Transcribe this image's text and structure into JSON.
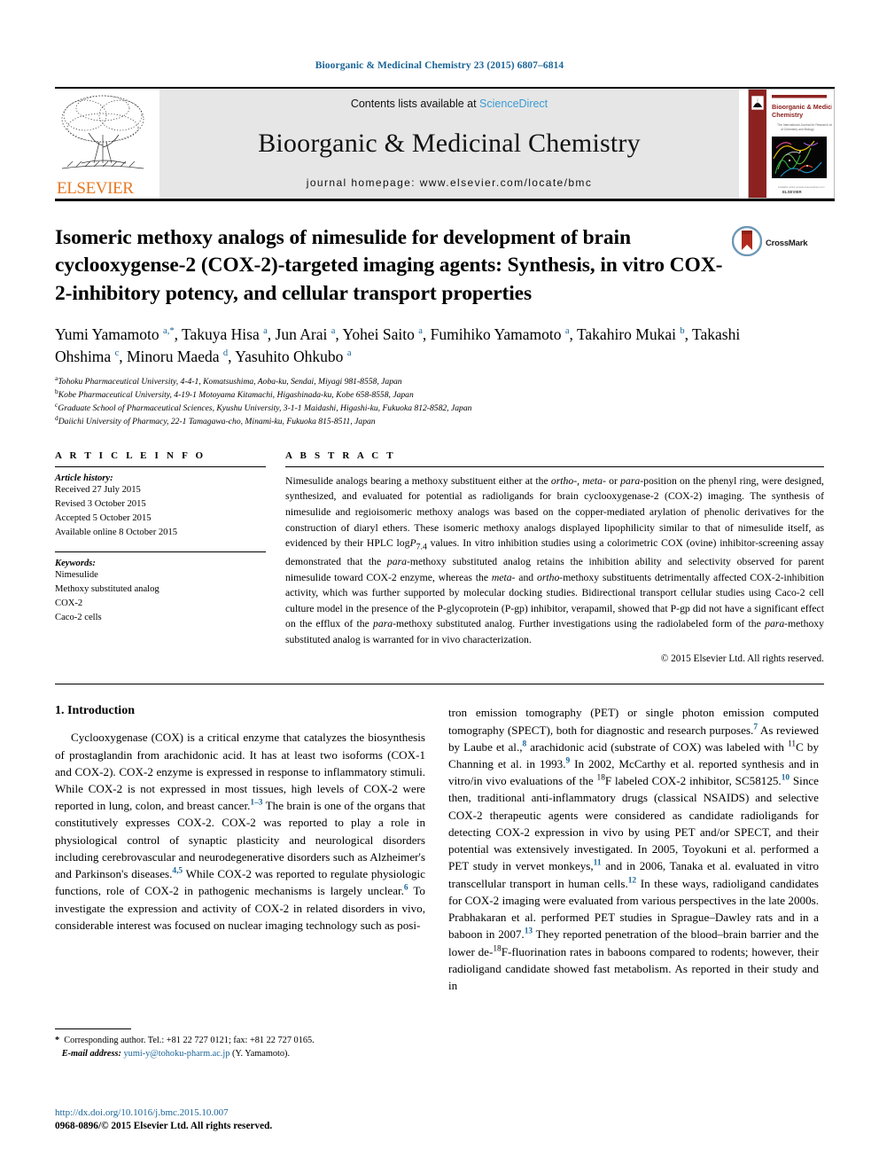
{
  "running_head": "Bioorganic & Medicinal Chemistry 23 (2015) 6807–6814",
  "masthead": {
    "contents_prefix": "Contents lists available at ",
    "sciencedirect": "ScienceDirect",
    "journal_title": "Bioorganic & Medicinal Chemistry",
    "homepage": "journal homepage: www.elsevier.com/locate/bmc",
    "publisher": "ELSEVIER",
    "cover_title_line1": "Bioorganic & Medicinal",
    "cover_title_line2": "Chemistry",
    "cover_sub": "The International Journal for Research at the Interface of Chemistry and Biology",
    "cover_footer": "ELSEVIER"
  },
  "title": "Isomeric methoxy analogs of nimesulide for development of brain cyclooxygense-2 (COX-2)-targeted imaging agents: Synthesis, in vitro COX-2-inhibitory potency, and cellular transport properties",
  "crossmark_label": "CrossMark",
  "authors_html": "Yumi Yamamoto <sup>a,*</sup>, Takuya Hisa <sup>a</sup>, Jun Arai <sup>a</sup>, Yohei Saito <sup>a</sup>, Fumihiko Yamamoto <sup>a</sup>, Takahiro Mukai <sup>b</sup>, Takashi Ohshima <sup>c</sup>, Minoru Maeda <sup>d</sup>, Yasuhito Ohkubo <sup>a</sup>",
  "affiliations": [
    {
      "marker": "a",
      "text": "Tohoku Pharmaceutical University, 4-4-1, Komatsushima, Aoba-ku, Sendai, Miyagi 981-8558, Japan"
    },
    {
      "marker": "b",
      "text": "Kobe Pharmaceutical University, 4-19-1 Motoyama Kitamachi, Higashinada-ku, Kobe 658-8558, Japan"
    },
    {
      "marker": "c",
      "text": "Graduate School of Pharmaceutical Sciences, Kyushu University, 3-1-1 Maidashi, Higashi-ku, Fukuoka 812-8582, Japan"
    },
    {
      "marker": "d",
      "text": "Daiichi University of Pharmacy, 22-1 Tamagawa-cho, Minami-ku, Fukuoka 815-8511, Japan"
    }
  ],
  "article_info": {
    "heading": "A R T I C L E    I N F O",
    "history_label": "Article history:",
    "history": [
      "Received 27 July 2015",
      "Revised 3 October 2015",
      "Accepted 5 October 2015",
      "Available online 8 October 2015"
    ],
    "keywords_label": "Keywords:",
    "keywords": [
      "Nimesulide",
      "Methoxy substituted analog",
      "COX-2",
      "Caco-2 cells"
    ]
  },
  "abstract": {
    "heading": "A B S T R A C T",
    "body_html": "Nimesulide analogs bearing a methoxy substituent either at the <i>ortho-</i>, <i>meta-</i> or <i>para-</i>position on the phenyl ring, were designed, synthesized, and evaluated for potential as radioligands for brain cyclooxygenase-2 (COX-2) imaging. The synthesis of nimesulide and regioisomeric methoxy analogs was based on the copper-mediated arylation of phenolic derivatives for the construction of diaryl ethers. These isomeric methoxy analogs displayed lipophilicity similar to that of nimesulide itself, as evidenced by their HPLC log<i>P</i><sub>7.4</sub> values. In vitro inhibition studies using a colorimetric COX (ovine) inhibitor-screening assay demonstrated that the <i>para-</i>methoxy substituted analog retains the inhibition ability and selectivity observed for parent nimesulide toward COX-2 enzyme, whereas the <i>meta-</i> and <i>ortho-</i>methoxy substituents detrimentally affected COX-2-inhibition activity, which was further supported by molecular docking studies. Bidirectional transport cellular studies using Caco-2 cell culture model in the presence of the P-glycoprotein (P-gp) inhibitor, verapamil, showed that P-gp did not have a significant effect on the efflux of the <i>para-</i>methoxy substituted analog. Further investigations using the radiolabeled form of the <i>para-</i>methoxy substituted analog is warranted for in vivo characterization.",
    "copyright": "© 2015 Elsevier Ltd. All rights reserved."
  },
  "introduction": {
    "heading": "1. Introduction",
    "left_html": "Cyclooxygenase (COX) is a critical enzyme that catalyzes the biosynthesis of prostaglandin from arachidonic acid. It has at least two isoforms (COX-1 and COX-2). COX-2 enzyme is expressed in response to inflammatory stimuli. While COX-2 is not expressed in most tissues, high levels of COX-2 were reported in lung, colon, and breast cancer.<span class=\"ref\">1–3</span> The brain is one of the organs that constitutively expresses COX-2. COX-2 was reported to play a role in physiological control of synaptic plasticity and neurological disorders including cerebrovascular and neurodegenerative disorders such as Alzheimer's and Parkinson's diseases.<span class=\"ref\">4,5</span> While COX-2 was reported to regulate physiologic functions, role of COX-2 in pathogenic mechanisms is largely unclear.<span class=\"ref\">6</span> To investigate the expression and activity of COX-2 in related disorders in vivo, considerable interest was focused on nuclear imaging technology such as posi-",
    "right_html": "tron emission tomography (PET) or single photon emission computed tomography (SPECT), both for diagnostic and research purposes.<span class=\"ref\">7</span> As reviewed by Laube et al.,<span class=\"ref\">8</span> arachidonic acid (substrate of COX) was labeled with <sup class=\"sm\">11</sup>C by Channing et al. in 1993.<span class=\"ref\">9</span> In 2002, McCarthy et al. reported synthesis and in vitro/in vivo evaluations of the <sup class=\"sm\">18</sup>F labeled COX-2 inhibitor, SC58125.<span class=\"ref\">10</span> Since then, traditional anti-inflammatory drugs (classical NSAIDS) and selective COX-2 therapeutic agents were considered as candidate radioligands for detecting COX-2 expression in vivo by using PET and/or SPECT, and their potential was extensively investigated. In 2005, Toyokuni et al. performed a PET study in vervet monkeys,<span class=\"ref\">11</span> and in 2006, Tanaka et al. evaluated in vitro transcellular transport in human cells.<span class=\"ref\">12</span> In these ways, radioligand candidates for COX-2 imaging were evaluated from various perspectives in the late 2000s. Prabhakaran et al. performed PET studies in Sprague–Dawley rats and in a baboon in 2007.<span class=\"ref\">13</span> They reported penetration of the blood–brain barrier and the lower de-<sup class=\"sm\">18</sup>F-fluorination rates in baboons compared to rodents; however, their radioligand candidate showed fast metabolism. As reported in their study and in"
  },
  "footnote": {
    "corresponding_html": "<b>*</b>&nbsp; Corresponding author. Tel.: +81 22 727 0121; fax: +81 22 727 0165.",
    "email_label": "E-mail address:",
    "email": "yumi-y@tohoku-pharm.ac.jp",
    "email_suffix": "(Y. Yamamoto)."
  },
  "bottom": {
    "doi": "http://dx.doi.org/10.1016/j.bmc.2015.10.007",
    "issn": "0968-0896/© 2015 Elsevier Ltd. All rights reserved."
  },
  "colors": {
    "link": "#1a6496",
    "sciencedirect": "#3a9bd5",
    "elsevier_orange": "#E87722",
    "cover_red": "#8C2220"
  }
}
